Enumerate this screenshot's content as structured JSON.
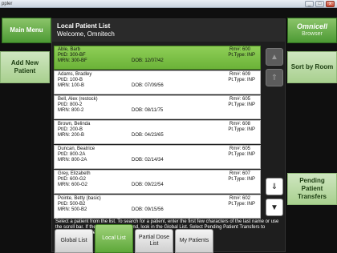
{
  "window": {
    "title": "ppler",
    "minimize": "_",
    "maximize": "□",
    "close": "x"
  },
  "sidebar": {
    "main_menu": "Main Menu",
    "add_new_patient": "Add New Patient"
  },
  "right": {
    "brand": "Omnicell",
    "brand_sub": "Browser",
    "sort_by_room": "Sort by Room",
    "pending_transfers": "Pending Patient Transfers"
  },
  "list": {
    "title": "Local Patient List",
    "subtitle": "Welcome, Omnitech",
    "patients": [
      {
        "name": "Able, Barb",
        "ptid": "PtID: 300-BF",
        "mrn": "MRN: 300-BF",
        "dob": "DOB: 12/07/42",
        "rm": "Rm#: 600",
        "pt": "Pt.Type: INP",
        "selected": true
      },
      {
        "name": "Adams, Bradley",
        "ptid": "PtID: 100-B",
        "mrn": "MRN: 100-B",
        "dob": "DOB: 07/09/56",
        "rm": "Rm#: 609",
        "pt": "Pt.Type: INP",
        "selected": false
      },
      {
        "name": "Bell, Alex (restock)",
        "ptid": "PtID: 800-2",
        "mrn": "MRN: 800-2",
        "dob": "DOB: 08/11/75",
        "rm": "Rm#: 605",
        "pt": "Pt.Type: INP",
        "selected": false
      },
      {
        "name": "Brown, Belinda",
        "ptid": "PtID: 200-B",
        "mrn": "MRN: 200-B",
        "dob": "DOB: 04/23/65",
        "rm": "Rm#: 608",
        "pt": "Pt.Type: INP",
        "selected": false
      },
      {
        "name": "Duncan, Beatrice",
        "ptid": "PtID: 800-2A",
        "mrn": "MRN: 800-2A",
        "dob": "DOB: 02/14/34",
        "rm": "Rm#: 605",
        "pt": "Pt.Type: INP",
        "selected": false
      },
      {
        "name": "Grey, Elizabeth",
        "ptid": "PtID: 600-G2",
        "mrn": "MRN: 600-G2",
        "dob": "DOB: 09/22/54",
        "rm": "Rm#: 607",
        "pt": "Pt.Type: INP",
        "selected": false
      },
      {
        "name": "Pointe, Betty (basic)",
        "ptid": "PtID: 500-B2",
        "mrn": "MRN: 500-B2",
        "dob": "DOB: 09/15/56",
        "rm": "Rm#: 602",
        "pt": "Pt.Type: INP",
        "selected": false
      }
    ],
    "help_text": "Select a patient from the list. To search for a patient, enter the first few characters of the last name or use the scroll bar. If the patient is not found, look in the Global List. Select Pending Patient Transfers to transfer patient meds."
  },
  "scroll": {
    "page_up": "▲",
    "top": "⇑",
    "bottom": "⇓",
    "page_down": "▼"
  },
  "tabs": [
    {
      "label": "Global List",
      "active": false
    },
    {
      "label": "Local List",
      "active": true
    },
    {
      "label": "Partial Dose List",
      "active": false
    },
    {
      "label": "My Patients",
      "active": false
    }
  ]
}
